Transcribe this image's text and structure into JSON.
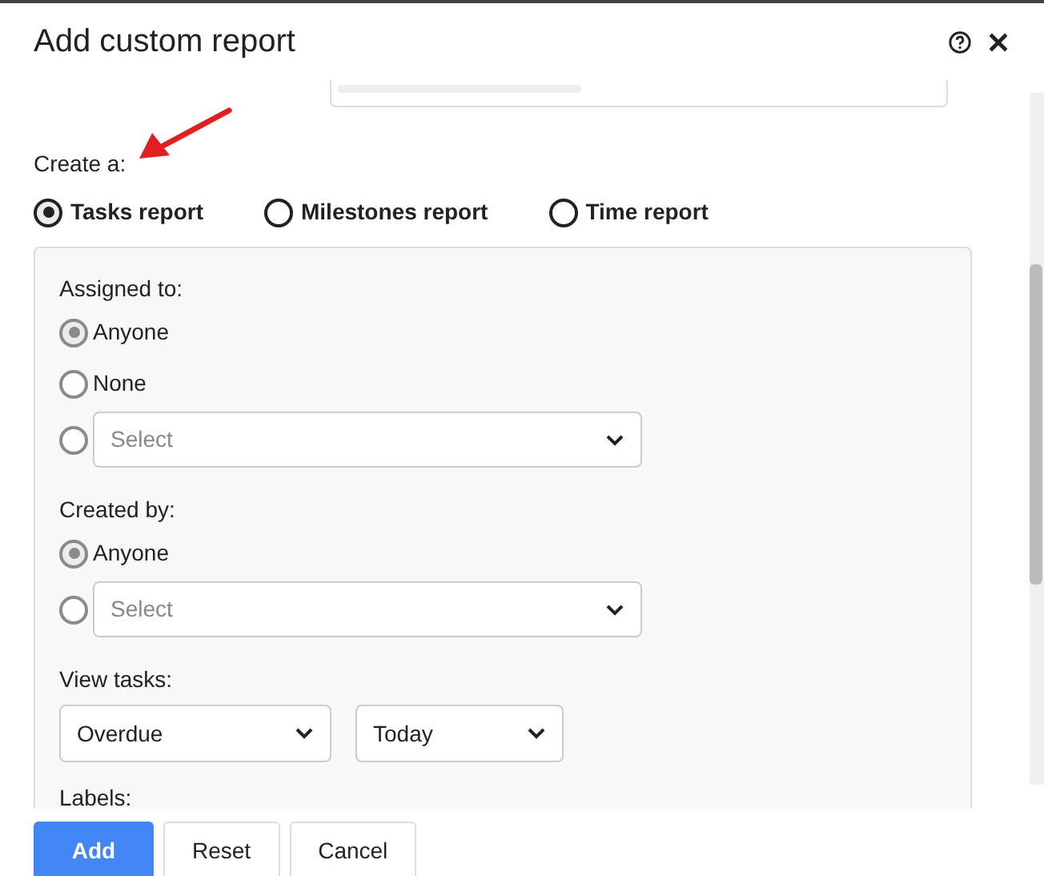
{
  "dialog": {
    "title": "Add custom report"
  },
  "create": {
    "label": "Create a:",
    "options": [
      {
        "label": "Tasks report",
        "selected": true
      },
      {
        "label": "Milestones report",
        "selected": false
      },
      {
        "label": "Time report",
        "selected": false
      }
    ]
  },
  "assigned_to": {
    "label": "Assigned to:",
    "options": [
      {
        "kind": "radio",
        "label": "Anyone",
        "selected": true
      },
      {
        "kind": "radio",
        "label": "None",
        "selected": false
      },
      {
        "kind": "select",
        "placeholder": "Select",
        "selected": false
      }
    ]
  },
  "created_by": {
    "label": "Created by:",
    "options": [
      {
        "kind": "radio",
        "label": "Anyone",
        "selected": true
      },
      {
        "kind": "select",
        "placeholder": "Select",
        "selected": false
      }
    ]
  },
  "view_tasks": {
    "label": "View tasks:",
    "selects": [
      "Overdue",
      "Today"
    ]
  },
  "labels": {
    "label": "Labels:"
  },
  "buttons": [
    {
      "label": "Add",
      "primary": true
    },
    {
      "label": "Reset",
      "primary": false
    },
    {
      "label": "Cancel",
      "primary": false
    }
  ]
}
